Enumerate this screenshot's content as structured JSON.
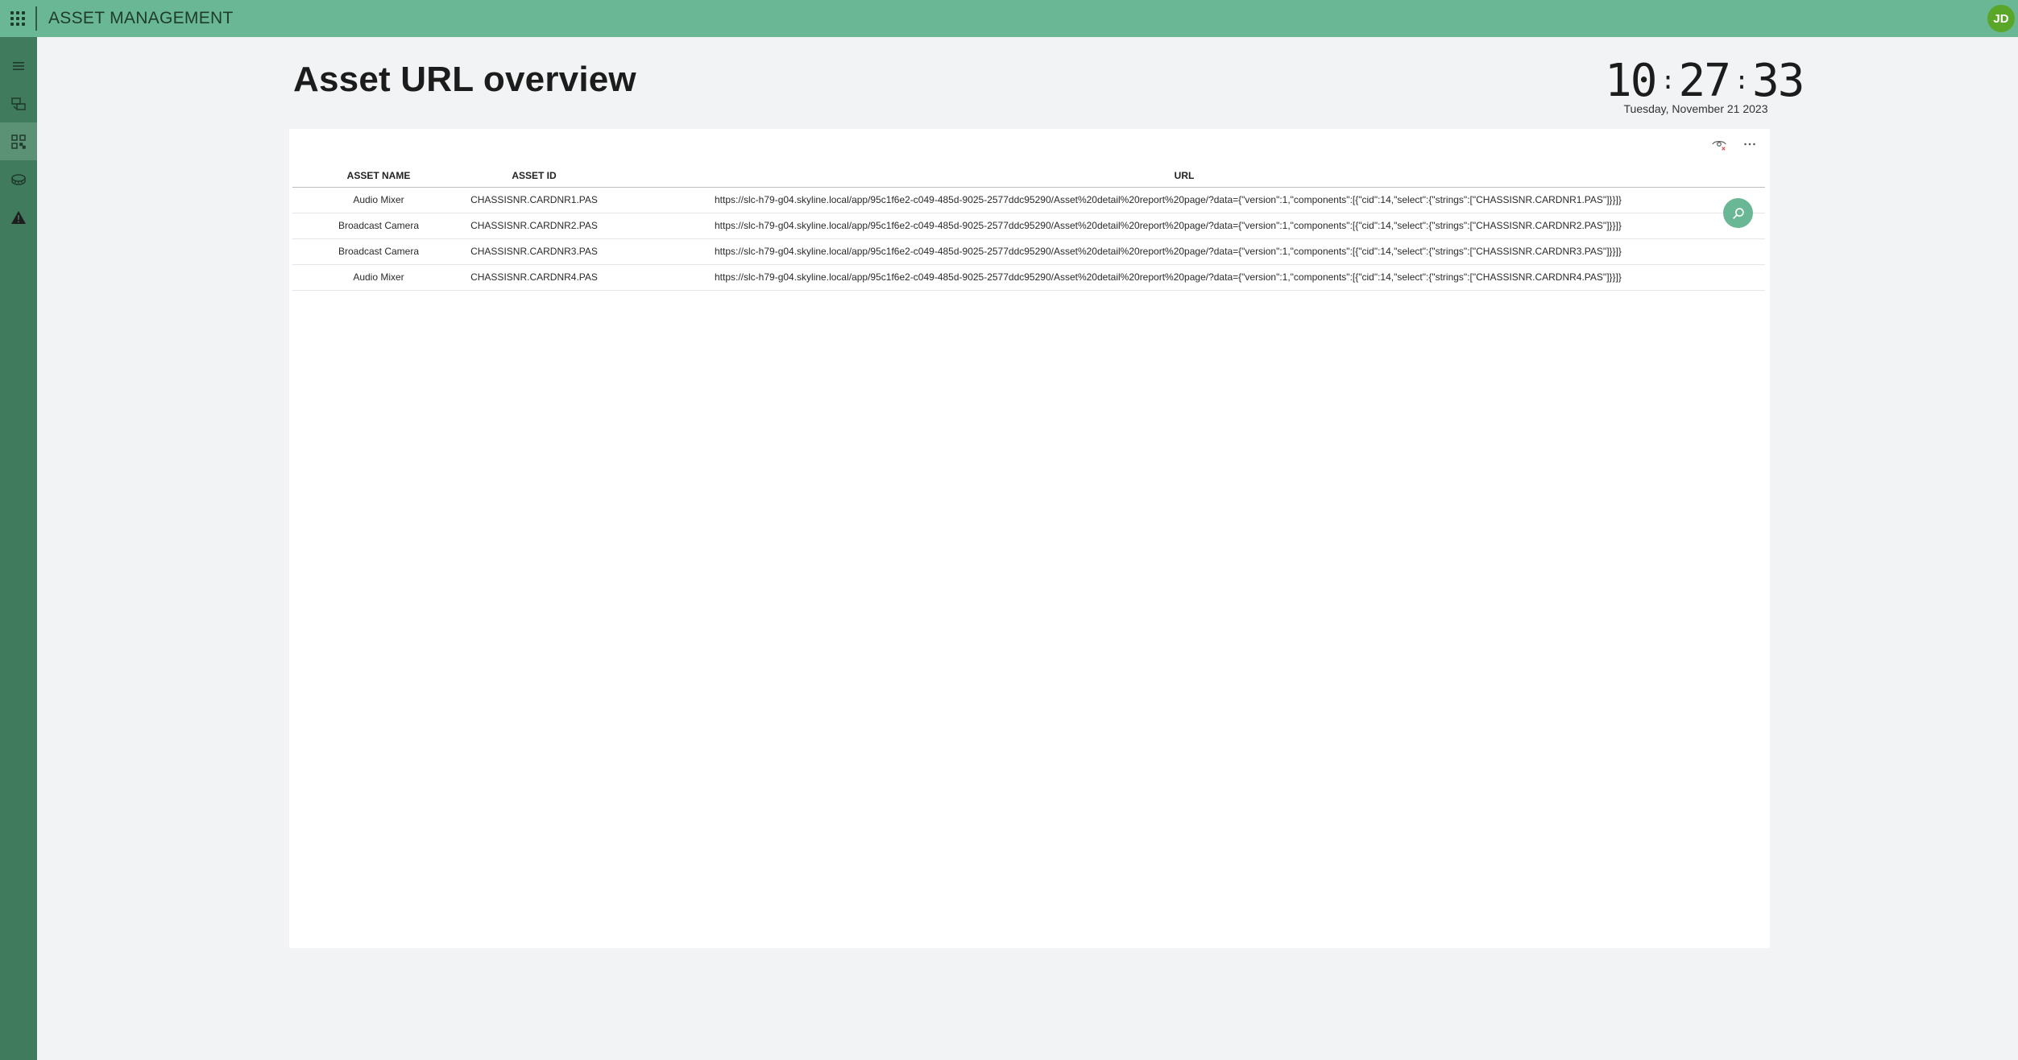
{
  "header": {
    "app_title": "ASSET MANAGEMENT",
    "user_initials": "JD",
    "apps_icon": "apps-grid-icon"
  },
  "sidebar": {
    "items": [
      {
        "icon": "hamburger-menu-icon",
        "active": false
      },
      {
        "icon": "asset-transfer-icon",
        "active": false
      },
      {
        "icon": "qr-code-icon",
        "active": true
      },
      {
        "icon": "storage-device-icon",
        "active": false
      },
      {
        "icon": "warning-icon",
        "active": false
      }
    ]
  },
  "page": {
    "title": "Asset URL overview"
  },
  "clock": {
    "hours": "10",
    "minutes": "27",
    "seconds": "33",
    "date": "Tuesday, November 21 2023"
  },
  "table": {
    "headers": {
      "asset_name": "ASSET NAME",
      "asset_id": "ASSET ID",
      "url": "URL"
    },
    "rows": [
      {
        "asset_name": "Audio Mixer",
        "asset_id": "CHASSISNR.CARDNR1.PAS",
        "url": "https://slc-h79-g04.skyline.local/app/95c1f6e2-c049-485d-9025-2577ddc95290/Asset%20detail%20report%20page/?data={\"version\":1,\"components\":[{\"cid\":14,\"select\":{\"strings\":[\"CHASSISNR.CARDNR1.PAS\"]}}]}"
      },
      {
        "asset_name": "Broadcast Camera",
        "asset_id": "CHASSISNR.CARDNR2.PAS",
        "url": "https://slc-h79-g04.skyline.local/app/95c1f6e2-c049-485d-9025-2577ddc95290/Asset%20detail%20report%20page/?data={\"version\":1,\"components\":[{\"cid\":14,\"select\":{\"strings\":[\"CHASSISNR.CARDNR2.PAS\"]}}]}"
      },
      {
        "asset_name": "Broadcast Camera",
        "asset_id": "CHASSISNR.CARDNR3.PAS",
        "url": "https://slc-h79-g04.skyline.local/app/95c1f6e2-c049-485d-9025-2577ddc95290/Asset%20detail%20report%20page/?data={\"version\":1,\"components\":[{\"cid\":14,\"select\":{\"strings\":[\"CHASSISNR.CARDNR3.PAS\"]}}]}"
      },
      {
        "asset_name": "Audio Mixer",
        "asset_id": "CHASSISNR.CARDNR4.PAS",
        "url": "https://slc-h79-g04.skyline.local/app/95c1f6e2-c049-485d-9025-2577ddc95290/Asset%20detail%20report%20page/?data={\"version\":1,\"components\":[{\"cid\":14,\"select\":{\"strings\":[\"CHASSISNR.CARDNR4.PAS\"]}}]}"
      }
    ]
  },
  "panel_actions": {
    "visibility_icon": "eye-hidden-icon",
    "more_icon": "more-options-icon",
    "search_icon": "search-icon"
  },
  "colors": {
    "header": "#69b794",
    "sidebar": "#3f7b5c",
    "accent": "#69b794",
    "avatar": "#5aa629"
  }
}
